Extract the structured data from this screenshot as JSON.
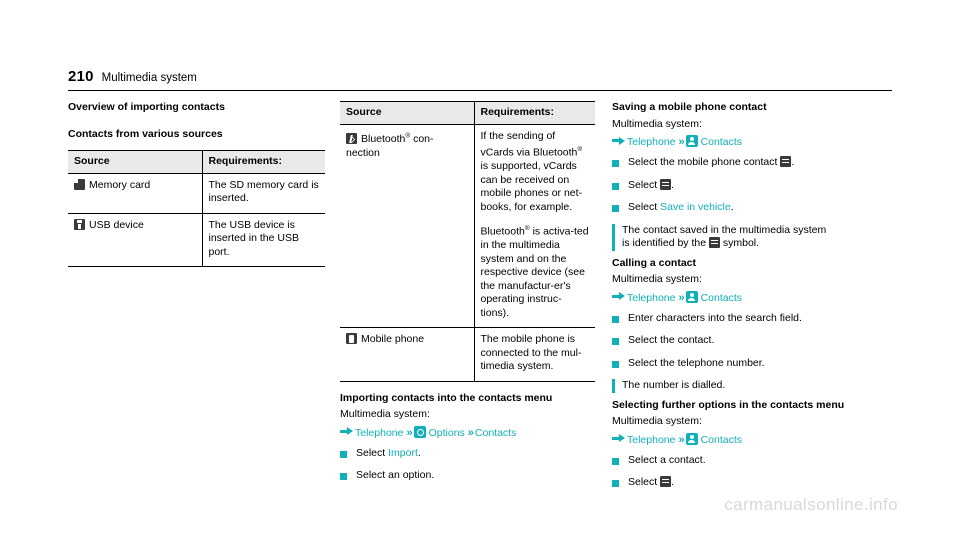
{
  "header": {
    "page_number": "210",
    "chapter": "Multimedia system"
  },
  "colors": {
    "accent": "#11b0b8",
    "table_header_bg": "#e9e9e9",
    "icon_dark": "#3a3a3a",
    "watermark": "#d8d8d8"
  },
  "column1": {
    "heading": "Overview of importing contacts",
    "subheading": "Contacts from various sources",
    "table": {
      "columns": [
        "Source",
        "Requirements:"
      ],
      "rows": [
        {
          "icon": "sd-card-icon",
          "source": "Memory card",
          "requirement": "The SD memory card is inserted."
        },
        {
          "icon": "usb-device-icon",
          "source": "USB device",
          "requirement": "The USB device is inserted in the USB port."
        }
      ]
    }
  },
  "column2": {
    "table": {
      "columns": [
        "Source",
        "Requirements:"
      ],
      "rows": [
        {
          "icon": "bluetooth-icon",
          "source": "Bluetooth® con-nection",
          "requirement_paragraphs": [
            "If the sending of vCards via Bluetooth® is supported, vCards can be received on mobile phones or net-books, for example.",
            "Bluetooth® is activa-ted in the multimedia system and on the respective device (see the manufactur-er's operating instruc-tions)."
          ]
        },
        {
          "icon": "mobile-phone-icon",
          "source": "Mobile phone",
          "requirement_paragraphs": [
            "The mobile phone is connected to the mul-timedia system."
          ]
        }
      ]
    },
    "section": {
      "heading": "Importing contacts into the contacts menu",
      "intro": "Multimedia system:",
      "path": {
        "arrow_icon": "arrow-right-icon",
        "item1": "Telephone",
        "chevron1": "»",
        "gear_icon": "options-gear-icon",
        "item2": "Options",
        "chevron2": "»",
        "item3": "Contacts"
      },
      "steps": [
        {
          "prefix": "Select ",
          "link": "Import",
          "suffix": "."
        },
        {
          "prefix": "Select an option.",
          "link": "",
          "suffix": ""
        }
      ]
    }
  },
  "column3": {
    "sections": [
      {
        "heading": "Saving a mobile phone contact",
        "intro": "Multimedia system:",
        "path": {
          "arrow_icon": "arrow-right-icon",
          "item1": "Telephone",
          "chevron1": "»",
          "contacts_icon": "contacts-icon",
          "item2": "Contacts"
        },
        "steps": [
          {
            "text_before": "Select the mobile phone contact ",
            "icon": "list-menu-icon",
            "text_after": "."
          },
          {
            "text_before": "Select ",
            "icon": "list-menu-icon",
            "text_after": "."
          },
          {
            "text_before": "Select ",
            "link": "Save in vehicle",
            "text_after": "."
          }
        ],
        "note": {
          "line1": "The contact saved in the multimedia system",
          "line2_before": "is identified by the ",
          "note_icon": "contact-symbol-icon",
          "line2_after": " symbol."
        }
      },
      {
        "heading": "Calling a contact",
        "intro": "Multimedia system:",
        "path": {
          "arrow_icon": "arrow-right-icon",
          "item1": "Telephone",
          "chevron1": "»",
          "contacts_icon": "contacts-icon",
          "item2": "Contacts"
        },
        "steps": [
          {
            "text": "Enter characters into the search field."
          },
          {
            "text": "Select the contact."
          },
          {
            "text": "Select the telephone number."
          }
        ],
        "note_plain": "The number is dialled."
      },
      {
        "heading": "Selecting further options in the contacts menu",
        "intro": "Multimedia system:",
        "path": {
          "arrow_icon": "arrow-right-icon",
          "item1": "Telephone",
          "chevron1": "»",
          "contacts_icon": "contacts-icon",
          "item2": "Contacts"
        },
        "steps": [
          {
            "text_before": "Select a contact.",
            "icon": "",
            "text_after": ""
          },
          {
            "text_before": "Select ",
            "icon": "list-menu-icon",
            "text_after": "."
          }
        ]
      }
    ]
  },
  "watermark": "carmanualsonline.info"
}
